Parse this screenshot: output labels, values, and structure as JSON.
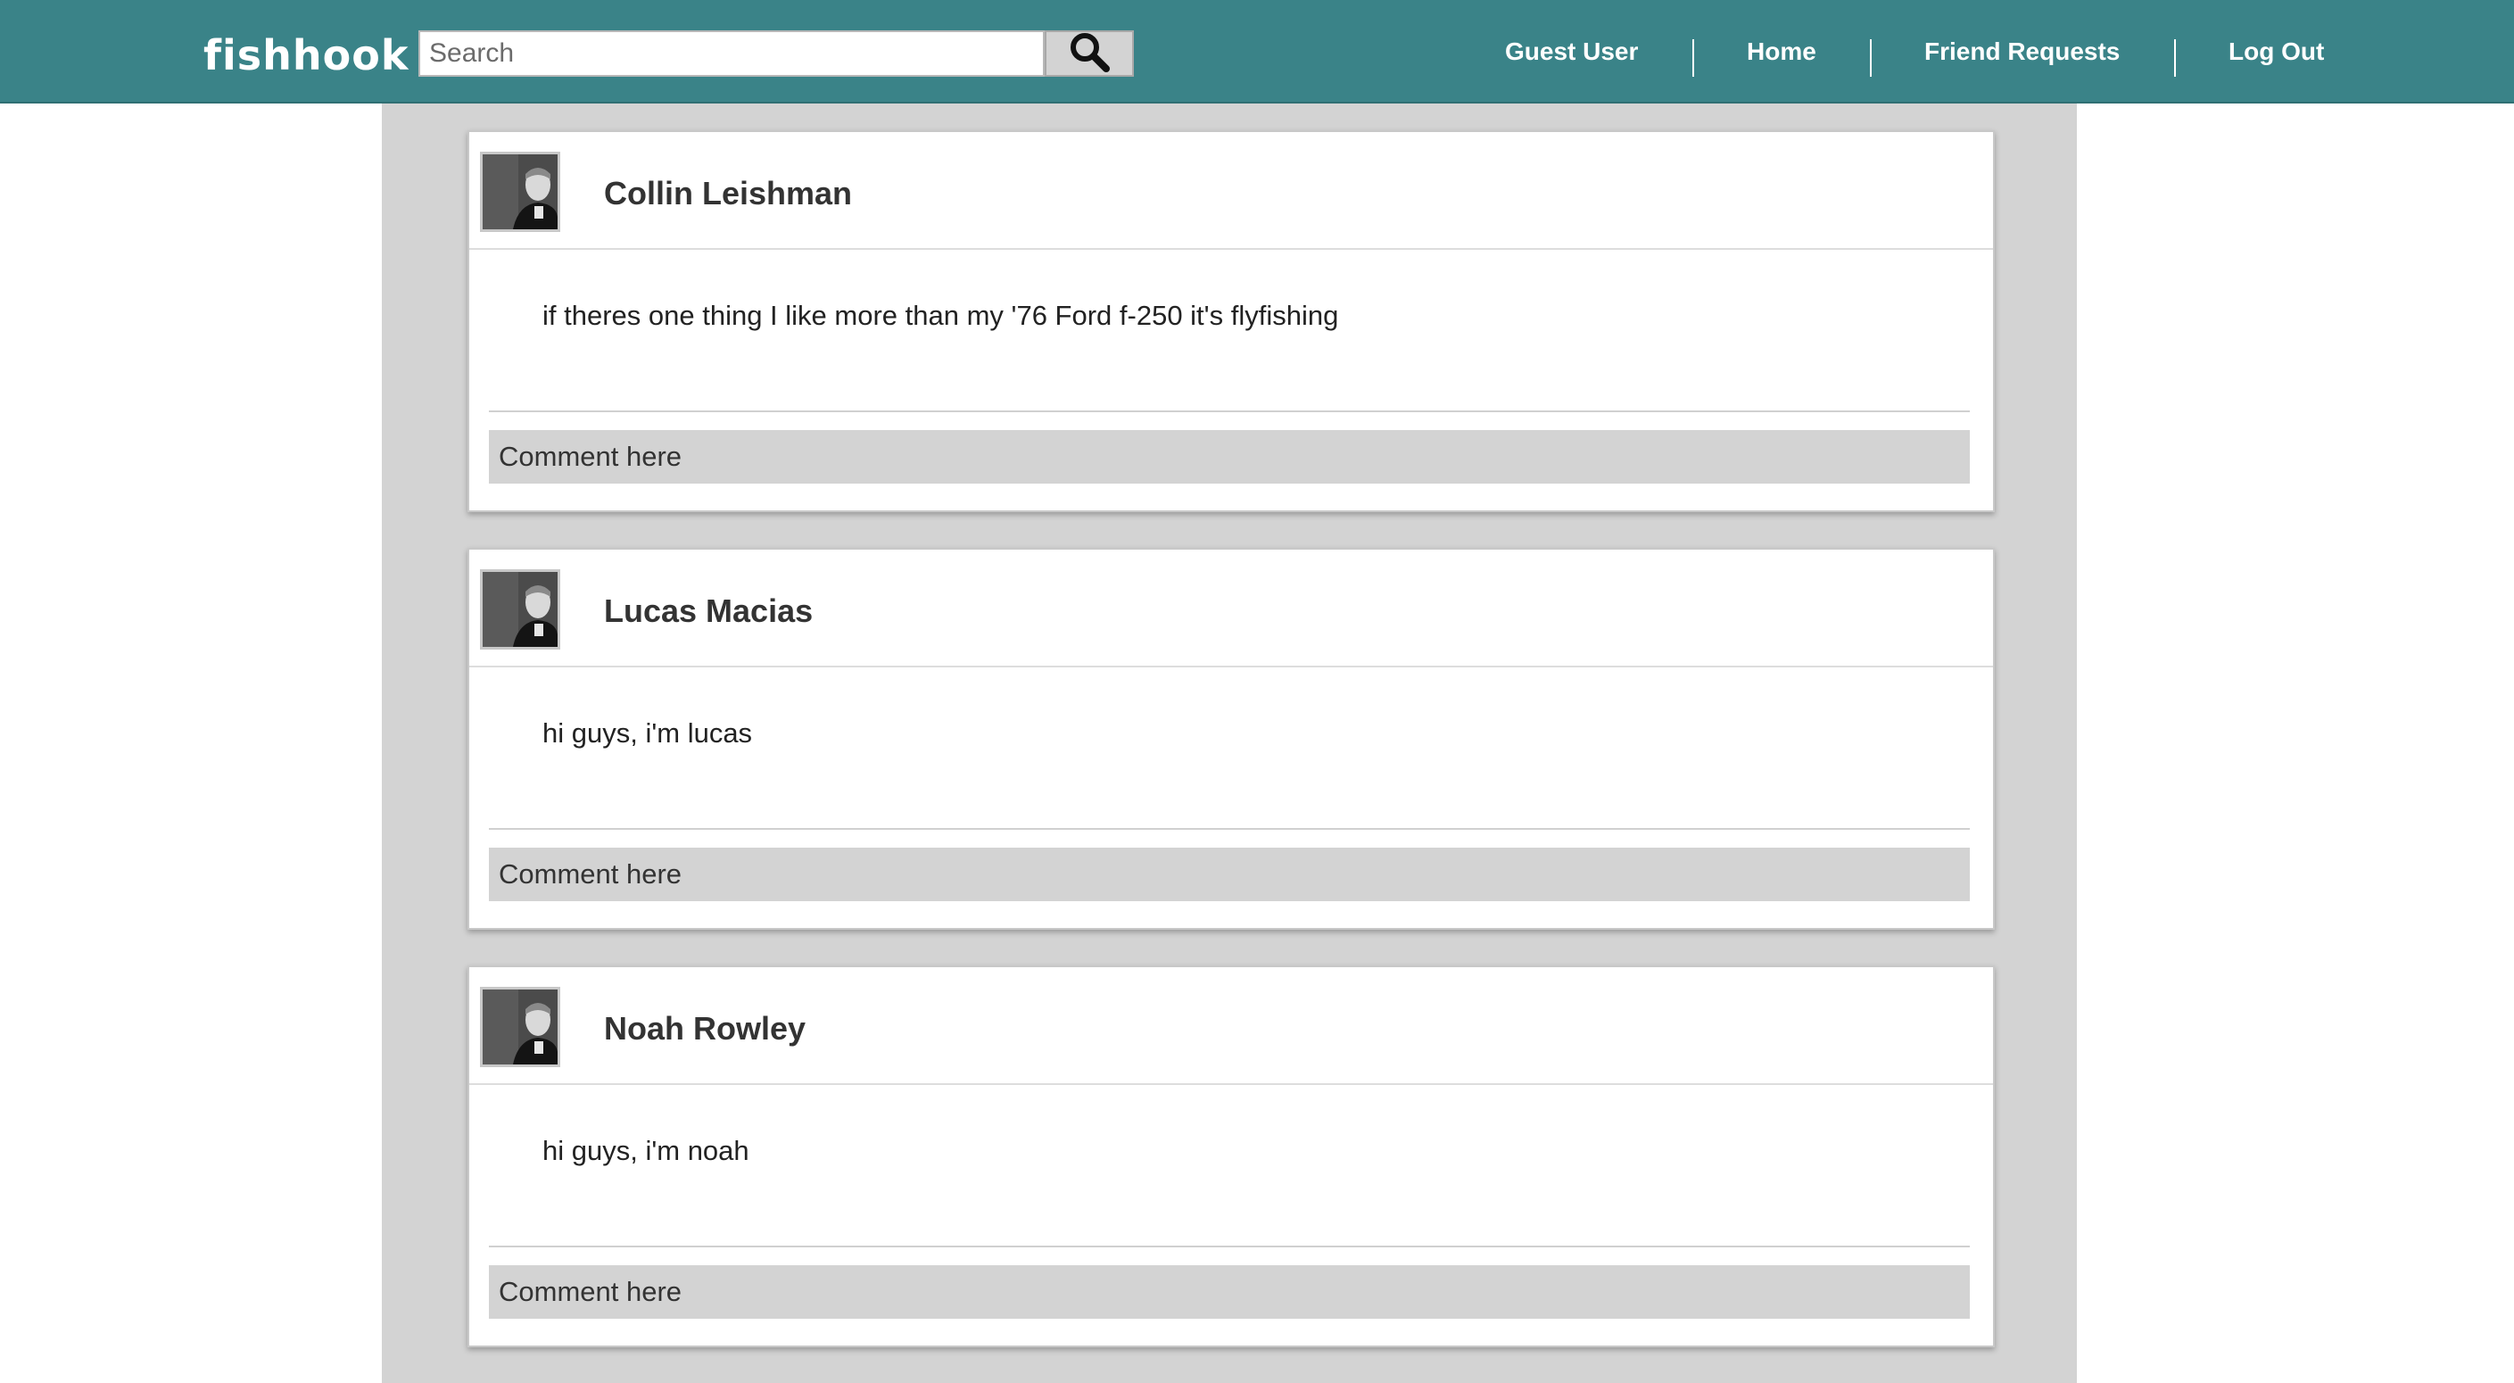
{
  "app": {
    "logo_text": "fishhook"
  },
  "search": {
    "placeholder": "Search",
    "value": ""
  },
  "nav": {
    "items": [
      {
        "label": "Guest User"
      },
      {
        "label": "Home"
      },
      {
        "label": "Friend Requests"
      },
      {
        "label": "Log Out"
      }
    ]
  },
  "colors": {
    "navbar": "#3a8388",
    "feed_background": "#d3d3d3",
    "comment_field": "#d3d3d3"
  },
  "icons": {
    "search": "search-icon",
    "avatar": "avatar"
  },
  "posts": [
    {
      "author": "Collin Leishman",
      "body": "if theres one thing I like more than my '76 Ford f-250 it's flyfishing",
      "comment_placeholder": "Comment here"
    },
    {
      "author": "Lucas Macias",
      "body": "hi guys, i'm lucas",
      "comment_placeholder": "Comment here"
    },
    {
      "author": "Noah Rowley",
      "body": "hi guys, i'm noah",
      "comment_placeholder": "Comment here"
    }
  ]
}
